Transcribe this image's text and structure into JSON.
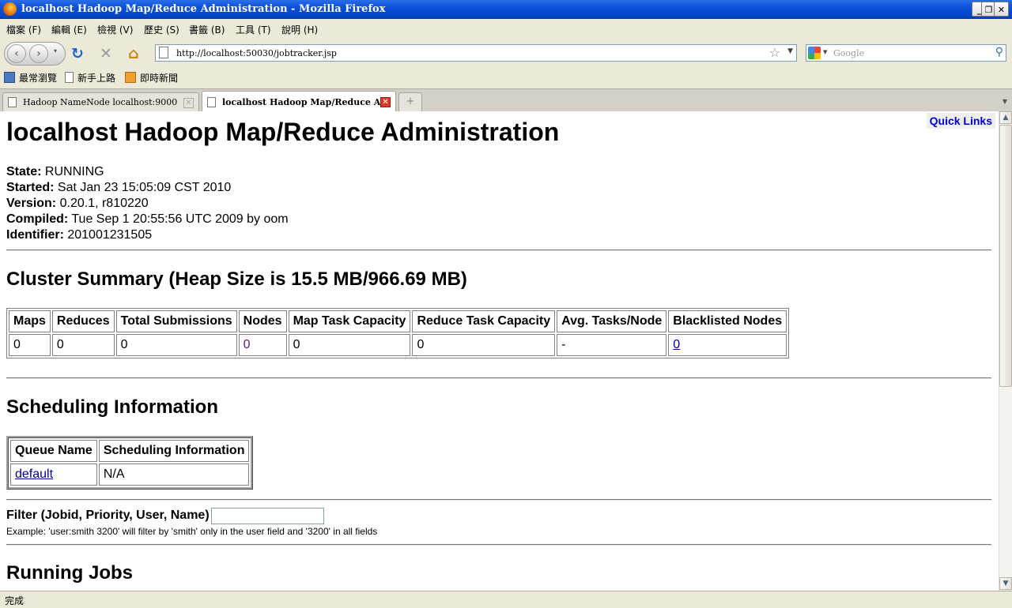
{
  "window": {
    "title": "localhost Hadoop Map/Reduce Administration - Mozilla Firefox",
    "minimize": "_",
    "maximize": "❐",
    "close": "✕"
  },
  "menu": [
    "檔案 (F)",
    "編輯 (E)",
    "檢視 (V)",
    "歷史 (S)",
    "書籤 (B)",
    "工具 (T)",
    "說明 (H)"
  ],
  "nav": {
    "url": "http://localhost:50030/jobtracker.jsp",
    "search_placeholder": "Google"
  },
  "bookmarks": [
    "最常瀏覽",
    "新手上路",
    "即時新聞"
  ],
  "tabs": [
    {
      "label": "Hadoop NameNode localhost:9000"
    },
    {
      "label": "localhost Hadoop Map/Reduce A···"
    }
  ],
  "page": {
    "quick_links": "Quick Links",
    "heading": "localhost Hadoop Map/Reduce Administration",
    "info": [
      {
        "label": "State:",
        "value": "RUNNING"
      },
      {
        "label": "Started:",
        "value": "Sat Jan 23 15:05:09 CST 2010"
      },
      {
        "label": "Version:",
        "value": "0.20.1, r810220"
      },
      {
        "label": "Compiled:",
        "value": "Tue Sep 1 20:55:56 UTC 2009 by oom"
      },
      {
        "label": "Identifier:",
        "value": "201001231505"
      }
    ],
    "cluster_summary_title": "Cluster Summary (Heap Size is 15.5 MB/966.69 MB)",
    "cluster_table": {
      "headers": [
        "Maps",
        "Reduces",
        "Total Submissions",
        "Nodes",
        "Map Task Capacity",
        "Reduce Task Capacity",
        "Avg. Tasks/Node",
        "Blacklisted Nodes"
      ],
      "row": [
        "0",
        "0",
        "0",
        "0",
        "0",
        "0",
        "-",
        "0"
      ]
    },
    "scheduling_title": "Scheduling Information",
    "scheduling_table": {
      "headers": [
        "Queue Name",
        "Scheduling Information"
      ],
      "row": [
        "default",
        "N/A"
      ]
    },
    "filter_label": "Filter (Jobid, Priority, User, Name)",
    "filter_value": "",
    "filter_example": "Example: 'user:smith 3200' will filter by 'smith' only in the user field and '3200' in all fields",
    "running_jobs_title": "Running Jobs"
  },
  "status": "完成"
}
